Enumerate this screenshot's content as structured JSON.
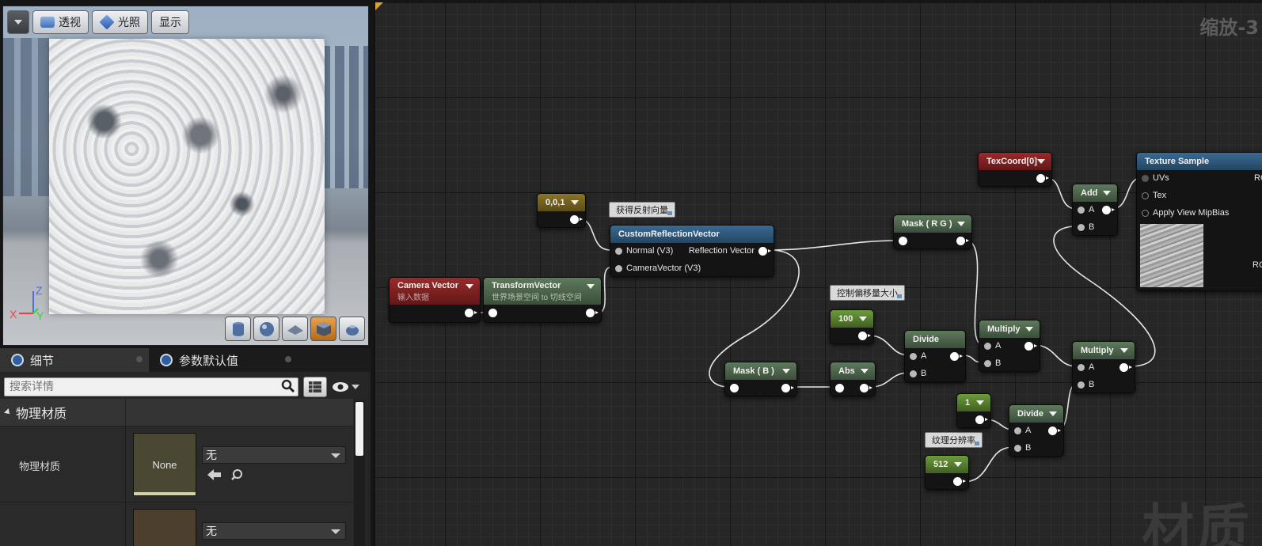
{
  "viewport": {
    "buttons": {
      "perspective": "透视",
      "lighting": "光照",
      "show": "显示"
    },
    "axes": {
      "z": "Z",
      "x": "X",
      "y": "Y"
    },
    "preview_shapes": [
      "cylinder-icon",
      "sphere-icon",
      "plane-icon",
      "cube-icon",
      "teapot-icon"
    ],
    "active_shape": "cube-icon"
  },
  "details": {
    "tabs": [
      {
        "label": "细节"
      },
      {
        "label": "参数默认值"
      }
    ],
    "search": {
      "placeholder": "搜索详情"
    },
    "category": "物理材质",
    "rows": [
      {
        "label": "物理材质",
        "thumb": "None",
        "value": "无"
      },
      {
        "label": "",
        "thumb": "",
        "value": "无"
      }
    ]
  },
  "graph": {
    "zoom": "缩放-3",
    "watermark": "材质",
    "comments": {
      "reflection": "获得反射向量",
      "offset": "控制偏移量大小",
      "resolution": "纹理分辨率"
    },
    "nodes": {
      "const001": {
        "title": "0,0,1"
      },
      "camera_vector": {
        "title": "Camera Vector",
        "subtitle": "输入数据"
      },
      "transform_vector": {
        "title": "TransformVector",
        "subtitle": "世界场景空间 to 切线空间"
      },
      "custom_reflection": {
        "title": "CustomReflectionVector",
        "in1": "Normal (V3)",
        "in2": "CameraVector (V3)",
        "out": "Reflection Vector"
      },
      "mask_rg": {
        "title": "Mask ( R G )"
      },
      "mask_b": {
        "title": "Mask ( B )"
      },
      "abs": {
        "title": "Abs"
      },
      "const100": {
        "title": "100"
      },
      "divide1": {
        "title": "Divide",
        "a": "A",
        "b": "B"
      },
      "multiply1": {
        "title": "Multiply",
        "a": "A",
        "b": "B"
      },
      "texcoord": {
        "title": "TexCoord[0]"
      },
      "add": {
        "title": "Add",
        "a": "A",
        "b": "B"
      },
      "multiply2": {
        "title": "Multiply",
        "a": "A",
        "b": "B"
      },
      "const1": {
        "title": "1"
      },
      "divide2": {
        "title": "Divide",
        "a": "A",
        "b": "B"
      },
      "const512": {
        "title": "512"
      },
      "texture_sample": {
        "title": "Texture Sample",
        "uvs": "UVs",
        "tex": "Tex",
        "mip": "Apply View MipBias",
        "out1": "RGB",
        "out2": "RGBA"
      }
    }
  },
  "colors": {
    "graph_bg": "#262626",
    "node_green": "#4b6449",
    "node_red": "#7d2020",
    "node_blue": "#2e5a80",
    "node_gold": "#74611f"
  }
}
